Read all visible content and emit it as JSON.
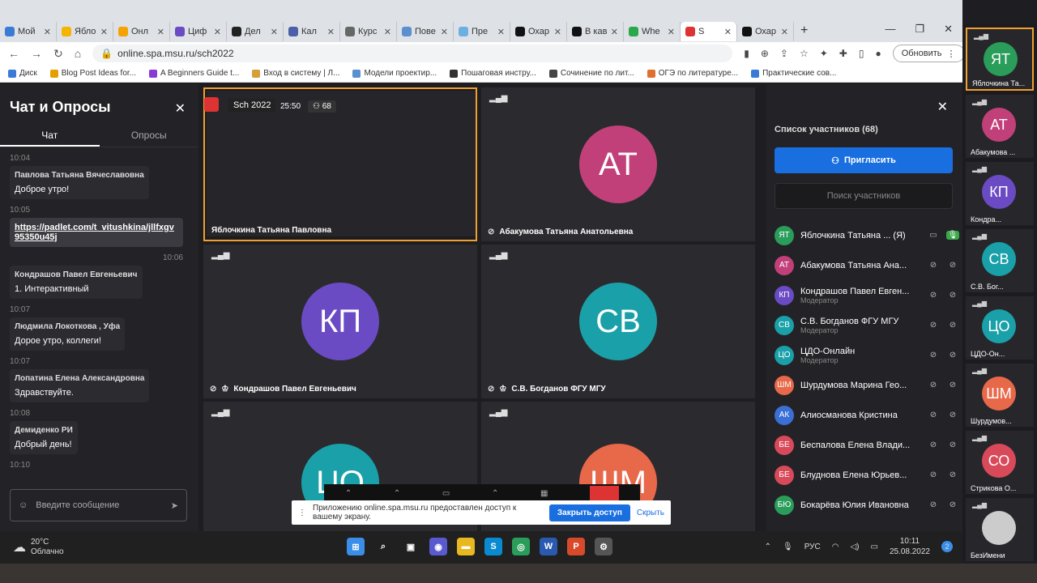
{
  "browser": {
    "tabs": [
      {
        "label": "Мой",
        "color": "#3a7bd5"
      },
      {
        "label": "Ябло",
        "color": "#f4b400"
      },
      {
        "label": "Онл",
        "color": "#f4a300"
      },
      {
        "label": "Циф",
        "color": "#6a4bc4"
      },
      {
        "label": "Дел",
        "color": "#222222"
      },
      {
        "label": "Кал",
        "color": "#4a5fa5"
      },
      {
        "label": "Курс",
        "color": "#666666"
      },
      {
        "label": "Пове",
        "color": "#5a8fd0"
      },
      {
        "label": "Пре",
        "color": "#6ab0e0"
      },
      {
        "label": "Охар",
        "color": "#111111"
      },
      {
        "label": "В кав",
        "color": "#111111"
      },
      {
        "label": "Whe",
        "color": "#2aa84a"
      },
      {
        "label": "S",
        "color": "#d33"
      },
      {
        "label": "Охар",
        "color": "#111111"
      }
    ],
    "url": "online.spa.msu.ru/sch2022",
    "update_label": "Обновить",
    "bookmarks": [
      {
        "label": "Диск",
        "color": "#3a7bd5"
      },
      {
        "label": "Blog Post Ideas for...",
        "color": "#e5a000"
      },
      {
        "label": "A Beginners Guide t...",
        "color": "#8a3ad5"
      },
      {
        "label": "Вход в систему | Л...",
        "color": "#d5a03a"
      },
      {
        "label": "Модели проектир...",
        "color": "#5a8fd0"
      },
      {
        "label": "Пошаговая инстру...",
        "color": "#333333"
      },
      {
        "label": "Сочинение по лит...",
        "color": "#444444"
      },
      {
        "label": "ОГЭ по литературе...",
        "color": "#e07030"
      },
      {
        "label": "Практические сов...",
        "color": "#3a7bd5"
      }
    ]
  },
  "chat": {
    "title": "Чат и Опросы",
    "tab_chat": "Чат",
    "tab_polls": "Опросы",
    "messages": [
      {
        "time": "10:04",
        "author": "Павлова Татьяна Вячеславовна",
        "text": "Доброе утро!"
      },
      {
        "time": "10:05",
        "author": "",
        "text": "https://padlet.com/t_vitushkina/jllfxgv95350u45j",
        "after": "10:06"
      },
      {
        "time": "",
        "author": "Кондрашов Павел Евгеньевич",
        "text": "1. Интерактивный"
      },
      {
        "time": "10:07",
        "author": "Людмила Локоткова , Уфа",
        "text": "Дорое утро, коллеги!"
      },
      {
        "time": "10:07",
        "author": "Лопатина Елена Александровна",
        "text": "Здравствуйте."
      },
      {
        "time": "10:08",
        "author": "Демиденко РИ",
        "text": "Добрый день!"
      },
      {
        "time": "10:10",
        "author": "",
        "text": ""
      }
    ],
    "input_placeholder": "Введите сообщение"
  },
  "meeting": {
    "room": "Sch 2022",
    "timer": "25:50",
    "count": "68",
    "tiles": [
      {
        "name": "Яблочкина Татьяна Павловна",
        "initials": "",
        "color": "#1c1c20"
      },
      {
        "name": "Абакумова Татьяна Анатольевна",
        "initials": "АТ",
        "color": "#c2407a"
      },
      {
        "name": "Кондрашов Павел Евгеньевич",
        "initials": "КП",
        "color": "#6a4bc4"
      },
      {
        "name": "С.В. Богданов ФГУ МГУ",
        "initials": "СВ",
        "color": "#1aa0a8"
      },
      {
        "name": "",
        "initials": "ЦО",
        "color": "#1aa0a8"
      },
      {
        "name": "",
        "initials": "ШМ",
        "color": "#e8684a"
      }
    ],
    "share_text": "Приложению online.spa.msu.ru предоставлен доступ к вашему экрану.",
    "share_ok": "Закрыть доступ",
    "share_hide": "Скрыть"
  },
  "participants": {
    "title": "Список участников (68)",
    "invite": "Пригласить",
    "search": "Поиск участников",
    "list": [
      {
        "initials": "ЯТ",
        "name": "Яблочкина Татьяна ... (Я)",
        "role": "",
        "color": "#2a9d5a"
      },
      {
        "initials": "АТ",
        "name": "Абакумова Татьяна Ана...",
        "role": "",
        "color": "#c2407a"
      },
      {
        "initials": "КП",
        "name": "Кондрашов Павел Евген...",
        "role": "Модератор",
        "color": "#6a4bc4"
      },
      {
        "initials": "СВ",
        "name": "С.В. Богданов ФГУ МГУ",
        "role": "Модератор",
        "color": "#1aa0a8"
      },
      {
        "initials": "ЦО",
        "name": "ЦДО-Онлайн",
        "role": "Модератор",
        "color": "#1aa0a8"
      },
      {
        "initials": "ШМ",
        "name": "Шурдумова Марина Гео...",
        "role": "",
        "color": "#e8684a"
      },
      {
        "initials": "АК",
        "name": "Алиосманова Кристина",
        "role": "",
        "color": "#3a6fd5"
      },
      {
        "initials": "БЕ",
        "name": "Беспалова Елена Влади...",
        "role": "",
        "color": "#d84a5a"
      },
      {
        "initials": "БЕ",
        "name": "Блуднова Елена Юрьев...",
        "role": "",
        "color": "#d84a5a"
      },
      {
        "initials": "БЮ",
        "name": "Бокарёва Юлия Ивановна",
        "role": "",
        "color": "#2a9d5a"
      }
    ]
  },
  "strip": [
    {
      "initials": "ЯТ",
      "label": "Яблочкина Та...",
      "color": "#2a9d5a"
    },
    {
      "initials": "АТ",
      "label": "Абакумова ...",
      "color": "#c2407a"
    },
    {
      "initials": "КП",
      "label": "Кондра...",
      "color": "#6a4bc4"
    },
    {
      "initials": "СВ",
      "label": "С.В. Бог...",
      "color": "#1aa0a8"
    },
    {
      "initials": "ЦО",
      "label": "ЦДО-Он...",
      "color": "#1aa0a8"
    },
    {
      "initials": "ШМ",
      "label": "Шурдумов...",
      "color": "#e8684a"
    },
    {
      "initials": "СО",
      "label": "Стрикова О...",
      "color": "#d84a5a"
    },
    {
      "initials": "",
      "label": "БезИмени",
      "color": "#cccccc"
    }
  ],
  "taskbar": {
    "temp": "20°C",
    "weather": "Облачно",
    "lang": "РУС",
    "time": "10:11",
    "date": "25.08.2022",
    "badge": "2"
  }
}
